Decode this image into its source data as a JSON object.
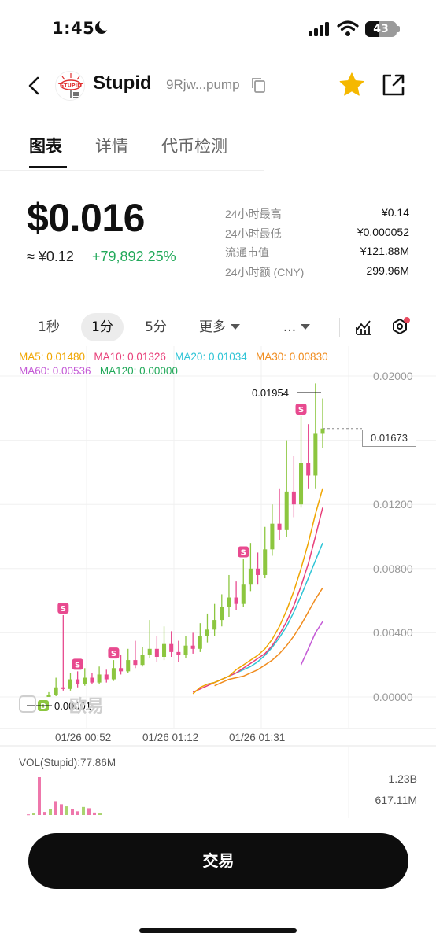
{
  "status_bar": {
    "time": "1:45",
    "battery": "43",
    "battery_level": 0.43
  },
  "header": {
    "token_name": "Stupid",
    "token_address": "9Rjw...pump",
    "logo_text": "STUPID",
    "favorited": true
  },
  "tabs": [
    {
      "label": "图表",
      "active": true
    },
    {
      "label": "详情",
      "active": false
    },
    {
      "label": "代币检测",
      "active": false
    }
  ],
  "price": {
    "usd": "$0.016",
    "cny": "≈ ¥0.12",
    "change": "+79,892.25%"
  },
  "stats": [
    {
      "label": "24小时最高",
      "value": "¥0.14"
    },
    {
      "label": "24小时最低",
      "value": "¥0.000052"
    },
    {
      "label": "流通市值",
      "value": "¥121.88M"
    },
    {
      "label": "24小时额 (CNY)",
      "value": "299.96M"
    }
  ],
  "intervals": {
    "options": [
      "1秒",
      "1分",
      "5分"
    ],
    "active": "1分",
    "more_label": "更多",
    "ellipsis_label": "..."
  },
  "ma_legend": {
    "ma5": "MA5: 0.01480",
    "ma10": "MA10: 0.01326",
    "ma20": "MA20: 0.01034",
    "ma30": "MA30: 0.00830",
    "ma60": "MA60: 0.00536",
    "ma120": "MA120: 0.00000"
  },
  "colors": {
    "up": "#8cc63f",
    "down": "#e84a8f",
    "ma5": "#f0a500",
    "ma10": "#e8407a",
    "ma20": "#2ec4d6",
    "ma30": "#f08c1e",
    "ma60": "#c45ad6",
    "ma120": "#22a95a",
    "accent_star": "#f5b800"
  },
  "chart": {
    "y_labels": [
      "0.02000",
      "0.01200",
      "0.00800",
      "0.00400",
      "0.00000"
    ],
    "time_labels": [
      "01/26 00:52",
      "01/26 01:12",
      "01/26 01:31"
    ],
    "current_price": "0.01673",
    "high_marker": "0.01954",
    "low_marker": "0.00001",
    "watermark": "欧易",
    "sell_marker": "S",
    "buy_marker": "B"
  },
  "volume": {
    "label": "VOL(Stupid):77.86M",
    "y_labels": [
      "1.23B",
      "617.11M"
    ]
  },
  "trade_button": "交易",
  "chart_data": {
    "type": "candlestick",
    "ylim": [
      0,
      0.021
    ],
    "candles": [
      {
        "o": 2e-05,
        "c": 0.0001,
        "h": 0.0003,
        "l": 1e-05
      },
      {
        "o": 0.0001,
        "c": 0.0006,
        "h": 0.0012,
        "l": 5e-05
      },
      {
        "o": 0.0006,
        "c": 0.0005,
        "h": 0.0051,
        "l": 0.0004
      },
      {
        "o": 0.0005,
        "c": 0.0011,
        "h": 0.0015,
        "l": 0.0004
      },
      {
        "o": 0.0011,
        "c": 0.0008,
        "h": 0.0016,
        "l": 0.0006
      },
      {
        "o": 0.0008,
        "c": 0.0012,
        "h": 0.0018,
        "l": 0.0007
      },
      {
        "o": 0.0012,
        "c": 0.0009,
        "h": 0.0015,
        "l": 0.0008
      },
      {
        "o": 0.0009,
        "c": 0.0014,
        "h": 0.0019,
        "l": 0.0008
      },
      {
        "o": 0.0014,
        "c": 0.0011,
        "h": 0.0017,
        "l": 0.0009
      },
      {
        "o": 0.0011,
        "c": 0.0018,
        "h": 0.0023,
        "l": 0.001
      },
      {
        "o": 0.0018,
        "c": 0.0016,
        "h": 0.0026,
        "l": 0.0014
      },
      {
        "o": 0.0016,
        "c": 0.0023,
        "h": 0.003,
        "l": 0.0015
      },
      {
        "o": 0.0023,
        "c": 0.002,
        "h": 0.0035,
        "l": 0.0018
      },
      {
        "o": 0.002,
        "c": 0.0026,
        "h": 0.0031,
        "l": 0.0019
      },
      {
        "o": 0.0026,
        "c": 0.003,
        "h": 0.0048,
        "l": 0.0024
      },
      {
        "o": 0.003,
        "c": 0.0025,
        "h": 0.0038,
        "l": 0.0022
      },
      {
        "o": 0.0025,
        "c": 0.0033,
        "h": 0.0044,
        "l": 0.0023
      },
      {
        "o": 0.0033,
        "c": 0.0028,
        "h": 0.0041,
        "l": 0.0025
      },
      {
        "o": 0.0028,
        "c": 0.0026,
        "h": 0.0035,
        "l": 0.0022
      },
      {
        "o": 0.0026,
        "c": 0.0032,
        "h": 0.0038,
        "l": 0.0024
      },
      {
        "o": 0.0032,
        "c": 0.003,
        "h": 0.004,
        "l": 0.0027
      },
      {
        "o": 0.003,
        "c": 0.0038,
        "h": 0.0046,
        "l": 0.0028
      },
      {
        "o": 0.0038,
        "c": 0.0042,
        "h": 0.0052,
        "l": 0.0034
      },
      {
        "o": 0.0042,
        "c": 0.0048,
        "h": 0.0058,
        "l": 0.0038
      },
      {
        "o": 0.0048,
        "c": 0.0056,
        "h": 0.0064,
        "l": 0.0044
      },
      {
        "o": 0.0056,
        "c": 0.0062,
        "h": 0.0076,
        "l": 0.005
      },
      {
        "o": 0.0062,
        "c": 0.0058,
        "h": 0.0072,
        "l": 0.0054
      },
      {
        "o": 0.0058,
        "c": 0.007,
        "h": 0.0086,
        "l": 0.0056
      },
      {
        "o": 0.007,
        "c": 0.008,
        "h": 0.0096,
        "l": 0.0066
      },
      {
        "o": 0.008,
        "c": 0.0076,
        "h": 0.009,
        "l": 0.007
      },
      {
        "o": 0.0076,
        "c": 0.0092,
        "h": 0.0106,
        "l": 0.0074
      },
      {
        "o": 0.0092,
        "c": 0.0108,
        "h": 0.012,
        "l": 0.0088
      },
      {
        "o": 0.0108,
        "c": 0.0104,
        "h": 0.013,
        "l": 0.0098
      },
      {
        "o": 0.0104,
        "c": 0.0128,
        "h": 0.016,
        "l": 0.01
      },
      {
        "o": 0.0128,
        "c": 0.012,
        "h": 0.015,
        "l": 0.0112
      },
      {
        "o": 0.012,
        "c": 0.0146,
        "h": 0.0175,
        "l": 0.0118
      },
      {
        "o": 0.0146,
        "c": 0.0138,
        "h": 0.017,
        "l": 0.013
      },
      {
        "o": 0.0138,
        "c": 0.0164,
        "h": 0.01954,
        "l": 0.013
      },
      {
        "o": 0.0164,
        "c": 0.01673,
        "h": 0.0186,
        "l": 0.0155
      }
    ],
    "ma_lines": {
      "ma5": [
        0.0002,
        0.0006,
        0.0008,
        0.0009,
        0.0011,
        0.0013,
        0.0017,
        0.002,
        0.0023,
        0.0026,
        0.003,
        0.0036,
        0.0044,
        0.0054,
        0.0066,
        0.008,
        0.0096,
        0.0114,
        0.013
      ],
      "ma10": [
        0.0003,
        0.0005,
        0.0007,
        0.0009,
        0.0011,
        0.0013,
        0.0015,
        0.0018,
        0.0021,
        0.0024,
        0.0027,
        0.0032,
        0.0039,
        0.0047,
        0.0057,
        0.0069,
        0.0083,
        0.01,
        0.0118
      ],
      "ma20": [
        0.0008,
        0.0009,
        0.0011,
        0.0013,
        0.0015,
        0.0017,
        0.0019,
        0.0022,
        0.0026,
        0.0031,
        0.0037,
        0.0044,
        0.0053,
        0.0063,
        0.0074,
        0.0085,
        0.0096
      ],
      "ma30": [
        0.0007,
        0.0009,
        0.0011,
        0.0012,
        0.0013,
        0.0015,
        0.0017,
        0.002,
        0.0023,
        0.0027,
        0.0032,
        0.0038,
        0.0045,
        0.0053,
        0.0061,
        0.0068
      ],
      "ma60": [
        0.002,
        0.003,
        0.004,
        0.0047
      ]
    },
    "sell_markers": [
      2,
      4,
      9,
      27,
      35
    ],
    "volume_values": [
      0.02,
      0.05,
      1.23,
      0.1,
      0.2,
      0.45,
      0.35,
      0.28,
      0.18,
      0.12,
      0.26,
      0.22,
      0.08,
      0.05
    ]
  }
}
